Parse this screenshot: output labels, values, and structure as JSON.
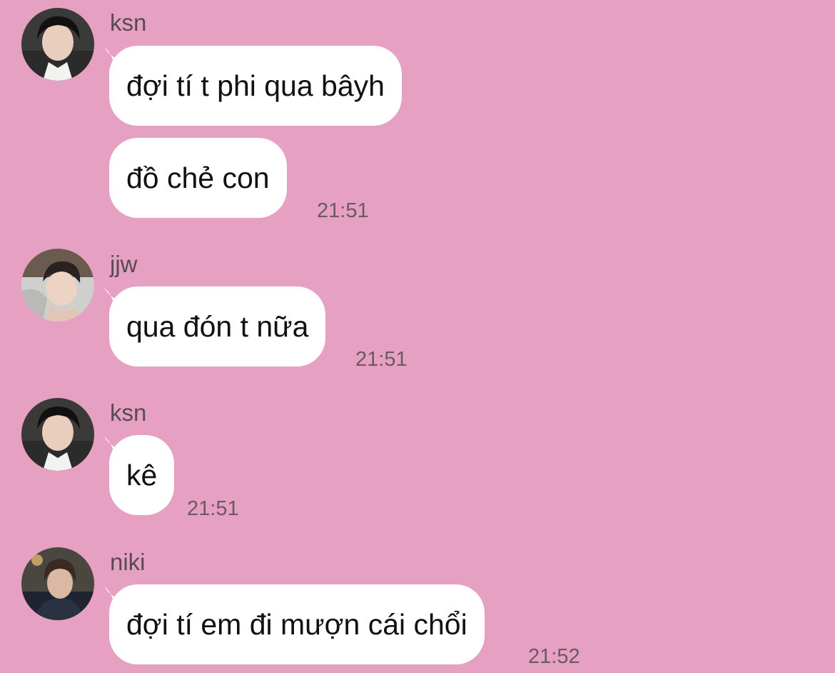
{
  "messages": [
    {
      "sender": "ksn",
      "avatar_icon": "profile-photo-ksn",
      "bubbles": [
        "đợi tí t phi qua bâyh",
        "đồ chẻ con"
      ],
      "time": "21:51"
    },
    {
      "sender": "jjw",
      "avatar_icon": "profile-photo-jjw",
      "bubbles": [
        "qua đón t nữa"
      ],
      "time": "21:51"
    },
    {
      "sender": "ksn",
      "avatar_icon": "profile-photo-ksn",
      "bubbles": [
        "kê"
      ],
      "time": "21:51"
    },
    {
      "sender": "niki",
      "avatar_icon": "profile-photo-niki",
      "bubbles": [
        "đợi tí em đi mượn cái chổi"
      ],
      "time": "21:52"
    }
  ],
  "colors": {
    "background": "#e6a0c1",
    "bubble": "#ffffff",
    "text": "#111111",
    "meta_text": "#6b5a63"
  }
}
